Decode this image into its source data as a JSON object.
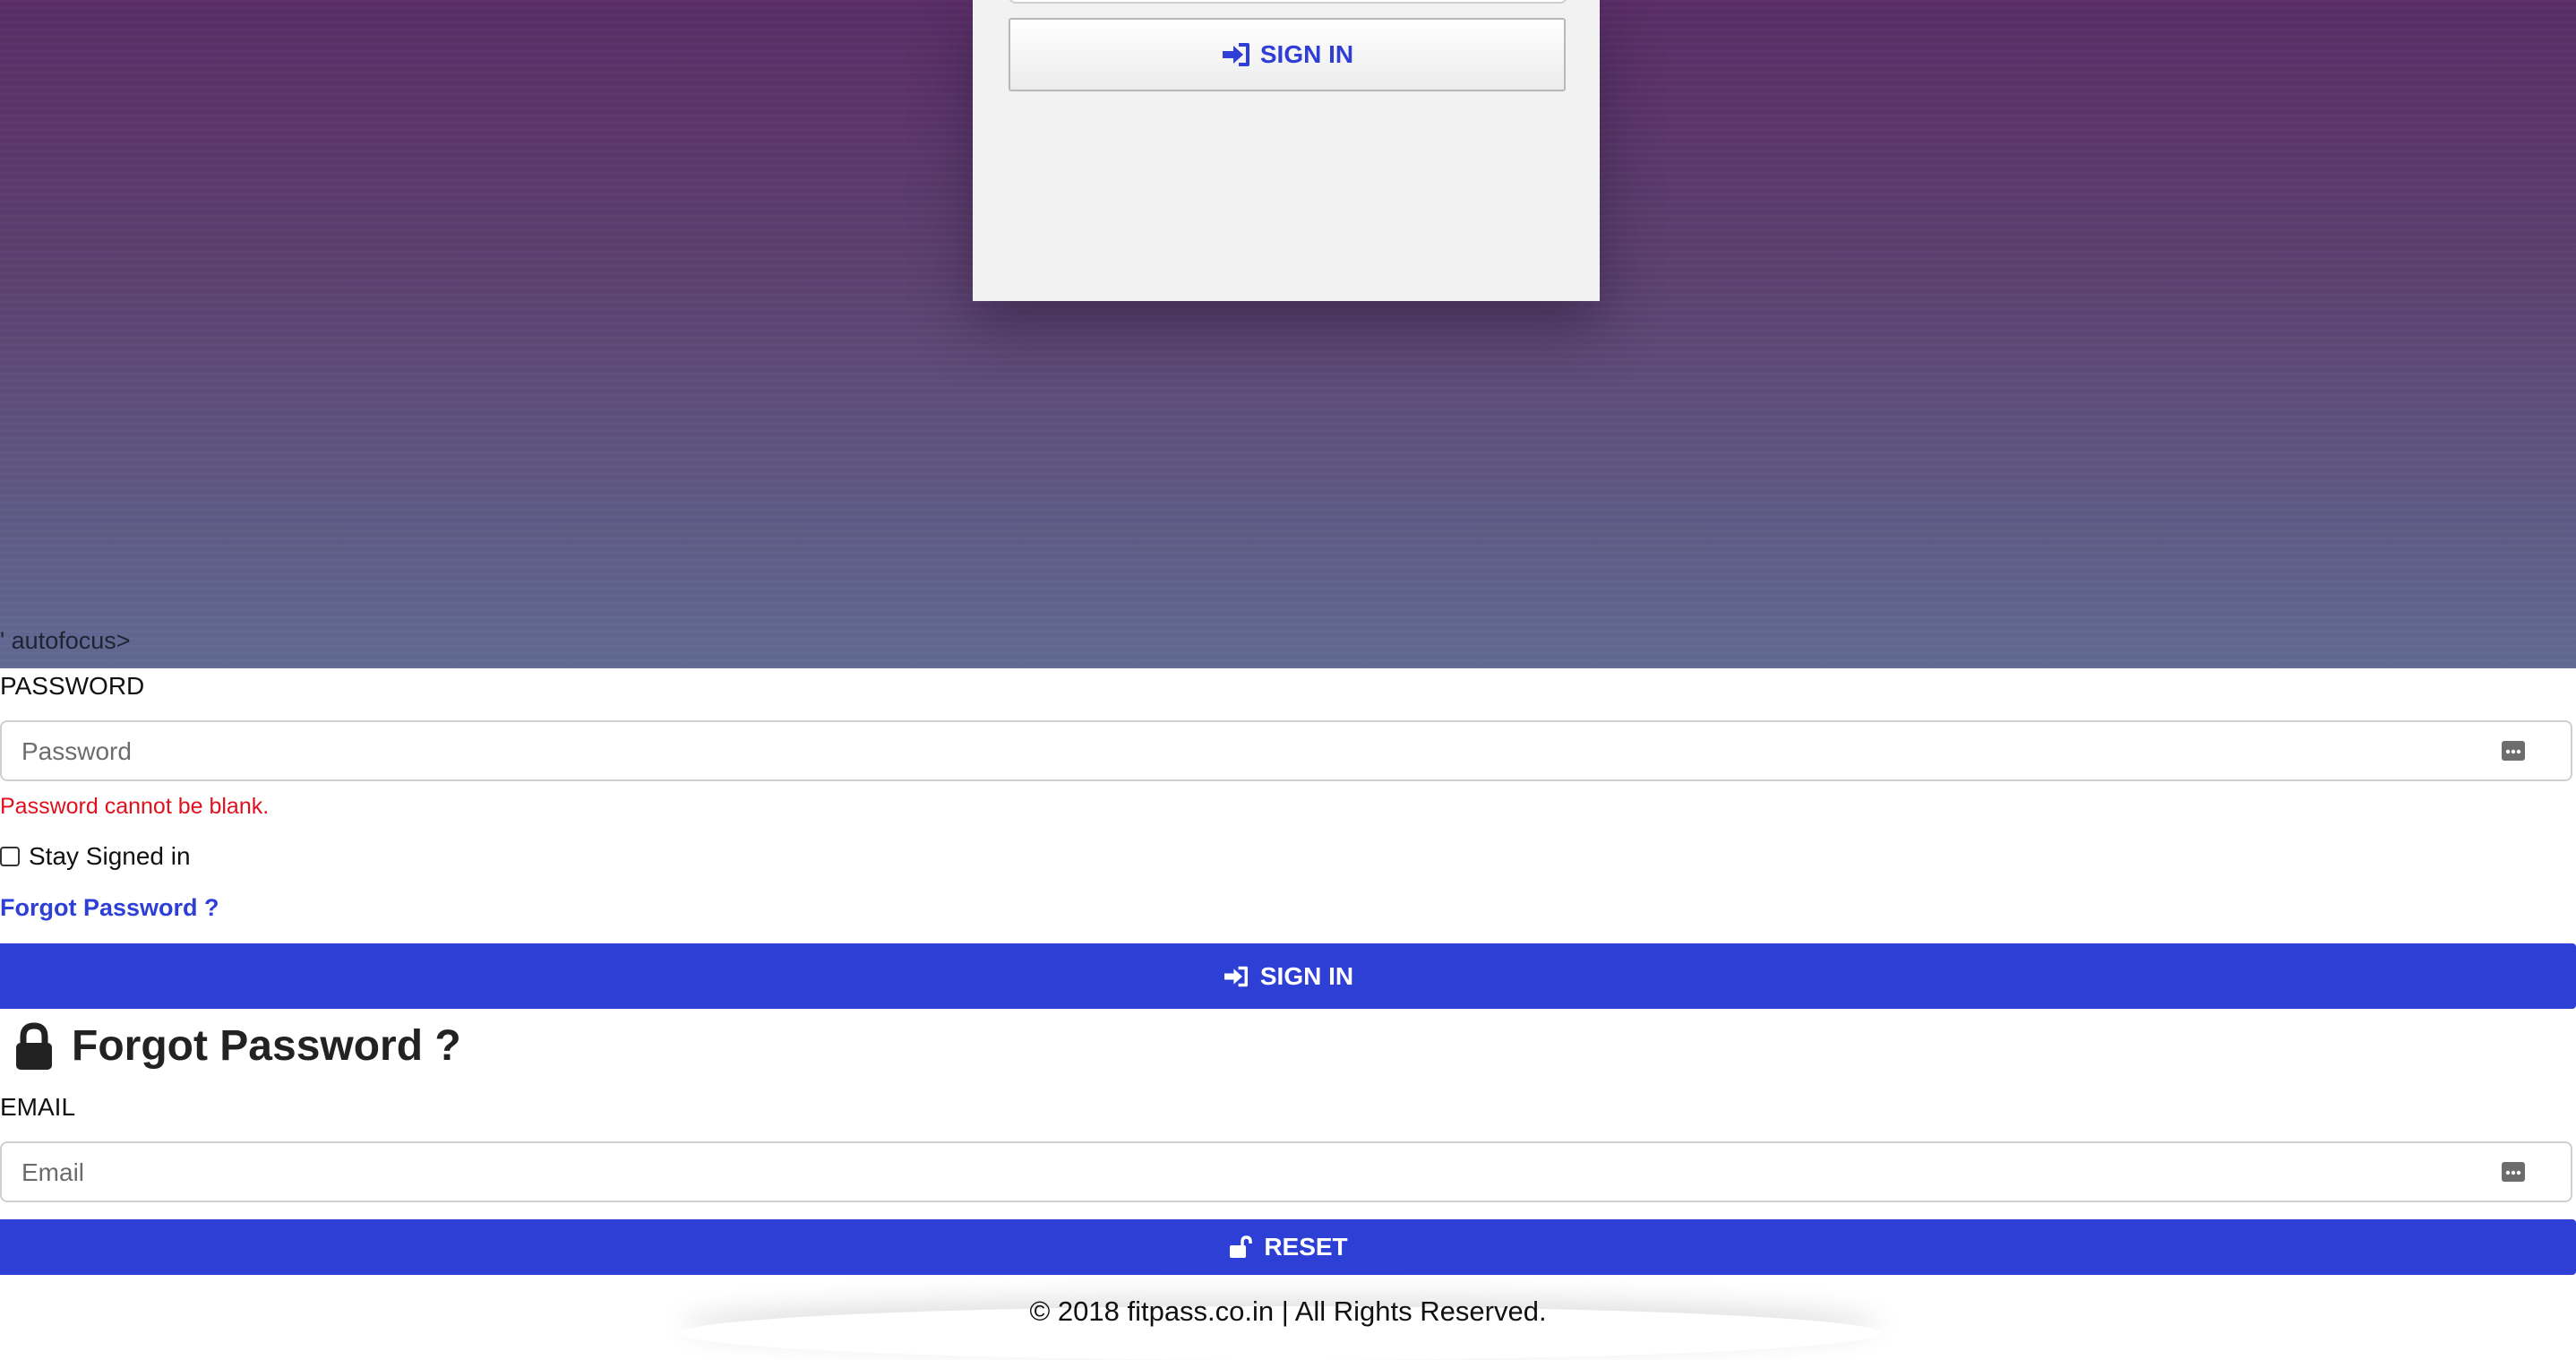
{
  "card": {
    "signin_label": "SIGN IN"
  },
  "stray_text": "' autofocus>",
  "login": {
    "password_label": "PASSWORD",
    "password_placeholder": "Password",
    "password_error": "Password cannot be blank.",
    "stay_signed_in_label": "Stay Signed in",
    "forgot_link": "Forgot Password ?",
    "signin_label": "SIGN IN"
  },
  "forgot": {
    "heading": "Forgot Password ?",
    "email_label": "EMAIL",
    "email_placeholder": "Email",
    "reset_label": "RESET"
  },
  "footer": {
    "text": "© 2018 fitpass.co.in | All Rights Reserved."
  },
  "icons": {
    "signin": "sign-in-icon",
    "field_key": "password-manager-key-icon",
    "lock": "lock-icon",
    "unlock": "unlock-icon"
  },
  "colors": {
    "primary": "#2e3fd6",
    "error": "#e0101d",
    "gradient_top": "#5a2d66",
    "gradient_bottom": "#606a92"
  }
}
